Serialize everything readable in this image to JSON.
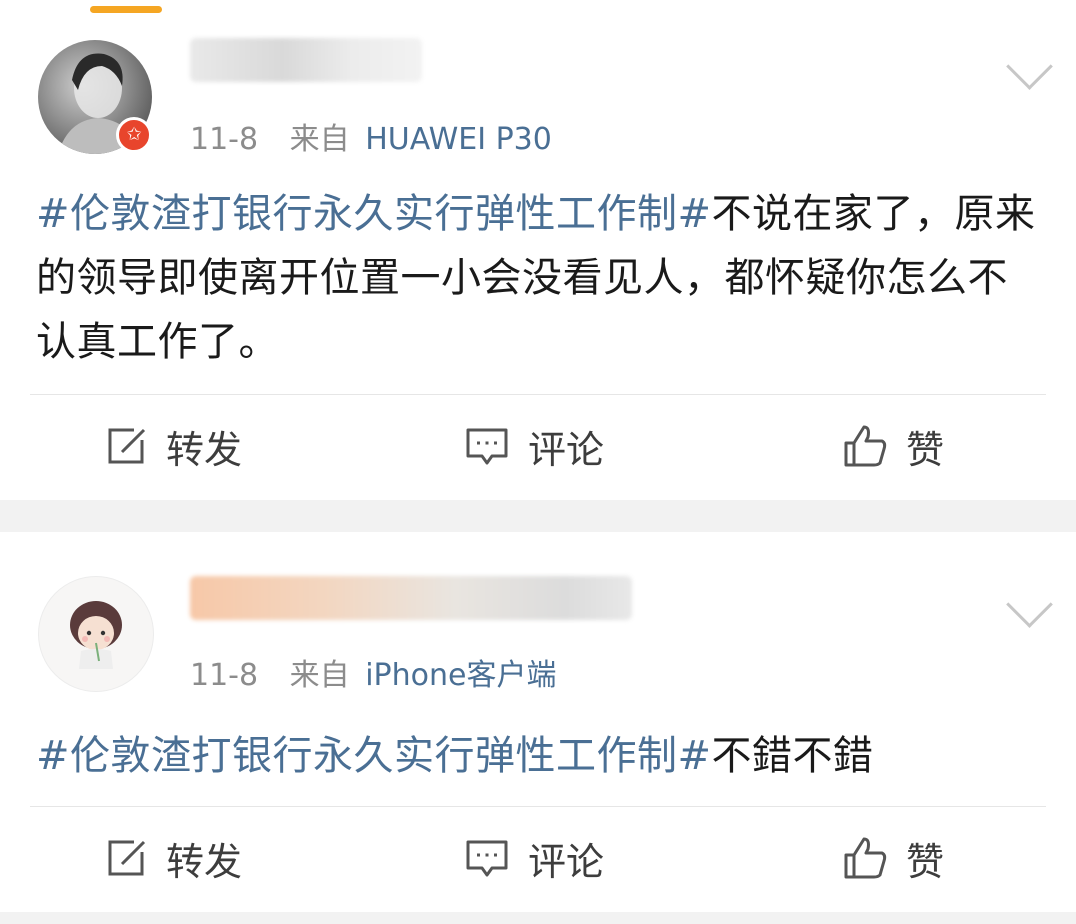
{
  "posts": [
    {
      "date": "11-8",
      "source_prefix": "来自",
      "source_device": "HUAWEI P30",
      "hashtag": "#伦敦渣打银行永久实行弹性工作制#",
      "text": "不说在家了，原来的领导即使离开位置一小会没看见人，都怀疑你怎么不认真工作了。",
      "actions": {
        "repost": "转发",
        "comment": "评论",
        "like": "赞"
      }
    },
    {
      "date": "11-8",
      "source_prefix": "来自",
      "source_device": "iPhone客户端",
      "hashtag": "#伦敦渣打银行永久实行弹性工作制#",
      "text": "不錯不錯",
      "actions": {
        "repost": "转发",
        "comment": "评论",
        "like": "赞"
      }
    }
  ],
  "colors": {
    "link_blue": "#4a6f94",
    "meta_gray": "#8c8c8c",
    "verified_red": "#e8452c",
    "tab_indicator": "#f5a623"
  },
  "icons": [
    "edit-repost-icon",
    "comment-icon",
    "thumbs-up-icon",
    "chevron-down-icon",
    "verified-badge-icon"
  ]
}
